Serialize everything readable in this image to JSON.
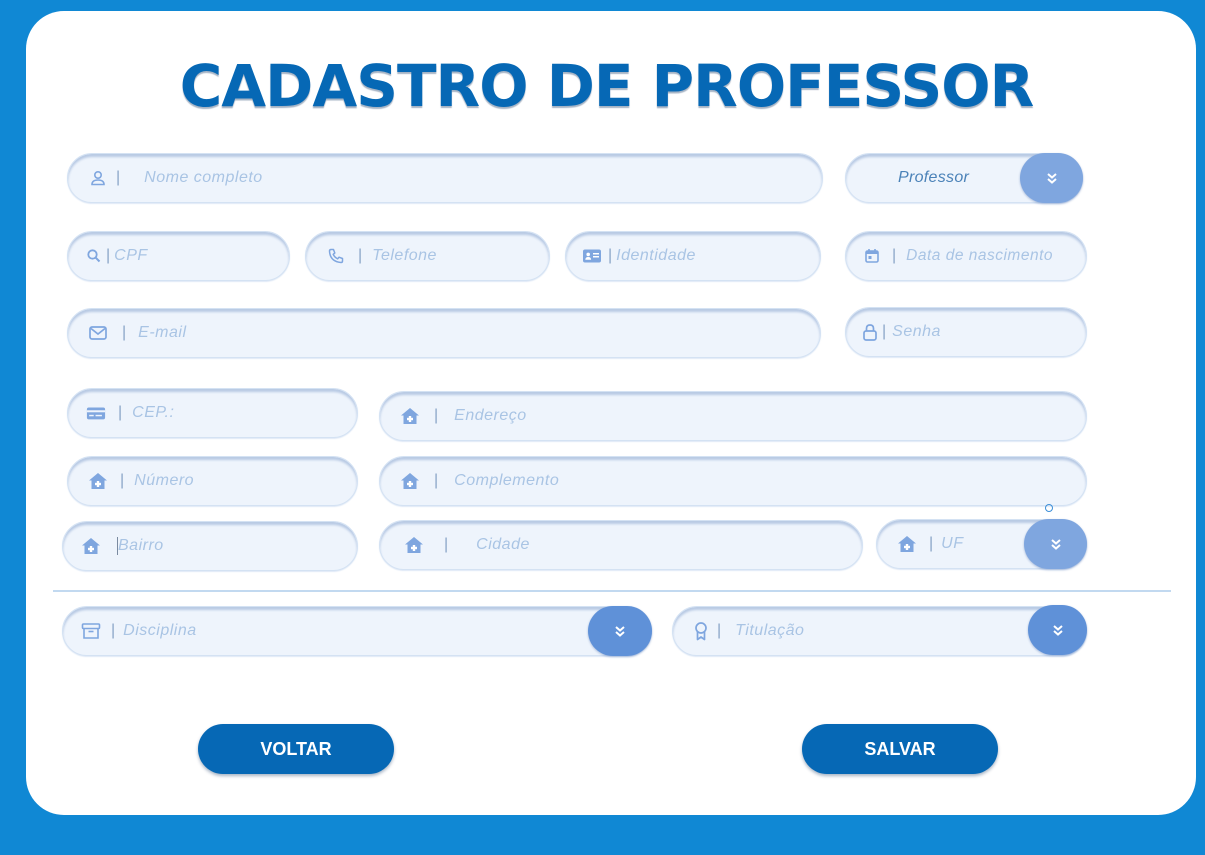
{
  "title": "CADASTRO DE PROFESSOR",
  "fields": {
    "nome": "Nome completo",
    "cargo": "Professor",
    "cpf": "CPF",
    "telefone": "Telefone",
    "identidade": "Identidade",
    "nascimento": "Data de nascimento",
    "email": "E-mail",
    "senha": "Senha",
    "cep": "CEP.:",
    "endereco": "Endereço",
    "numero": "Número",
    "complemento": "Complemento",
    "bairro": "Bairro",
    "cidade": "Cidade",
    "uf": "UF",
    "disciplina": "Disciplina",
    "titulacao": "Titulação"
  },
  "separator": "|",
  "buttons": {
    "voltar": "VOLTAR",
    "salvar": "SALVAR"
  },
  "colors": {
    "background": "#1088d4",
    "title": "#0668b5",
    "button": "#0668b5",
    "icon": "#7fa6df",
    "placeholder": "#a9c4e4"
  },
  "icons": {
    "nome": "user-icon",
    "cpf": "search-icon",
    "telefone": "phone-icon",
    "identidade": "id-card-icon",
    "nascimento": "calendar-icon",
    "email": "envelope-icon",
    "senha": "lock-icon",
    "cep": "card-icon",
    "address": "house-icon",
    "disciplina": "archive-icon",
    "titulacao": "award-icon",
    "dropdown": "chevron-double-down-icon"
  }
}
